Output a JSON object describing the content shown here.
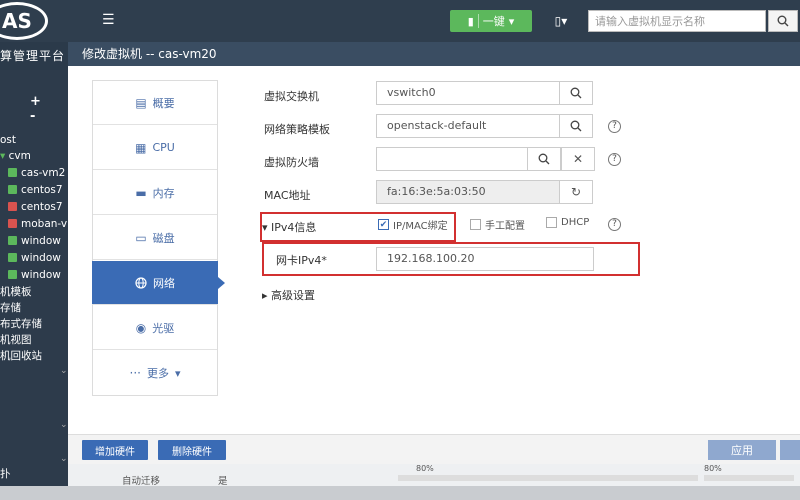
{
  "app": {
    "logo_text": "AS",
    "platform_title": "算管理平台"
  },
  "topbar": {
    "onekey_label": "一键",
    "search_placeholder": "请输入虚拟机显示名称"
  },
  "nav": {
    "tools_label": "+ -",
    "tree": [
      {
        "label": "ost",
        "icon": "none"
      },
      {
        "label": "cvm",
        "icon": "arrow"
      },
      {
        "label": "cas-vm2",
        "icon": "vm-running"
      },
      {
        "label": "centos7",
        "icon": "vm-running"
      },
      {
        "label": "centos7",
        "icon": "vm-stopped"
      },
      {
        "label": "moban-v",
        "icon": "vm-stopped"
      },
      {
        "label": "window",
        "icon": "vm-running"
      },
      {
        "label": "window",
        "icon": "vm-running"
      },
      {
        "label": "window",
        "icon": "vm-running"
      },
      {
        "label": "机模板",
        "icon": "none"
      },
      {
        "label": "存储",
        "icon": "none"
      },
      {
        "label": "布式存储",
        "icon": "none"
      },
      {
        "label": "机视图",
        "icon": "none"
      },
      {
        "label": "机回收站",
        "icon": "none"
      },
      {
        "label": "扑",
        "icon": "none"
      }
    ]
  },
  "modal": {
    "title": "修改虚拟机 -- cas-vm20",
    "tabs": [
      {
        "label": "概要",
        "icon": "summary-icon"
      },
      {
        "label": "CPU",
        "icon": "cpu-icon"
      },
      {
        "label": "内存",
        "icon": "memory-icon"
      },
      {
        "label": "磁盘",
        "icon": "disk-icon"
      },
      {
        "label": "网络",
        "icon": "network-icon"
      },
      {
        "label": "光驱",
        "icon": "cdrom-icon"
      },
      {
        "label": "更多",
        "icon": "more-icon"
      }
    ],
    "active_tab": "网络",
    "form": {
      "vswitch_label": "虚拟交换机",
      "vswitch_value": "vswitch0",
      "policy_label": "网络策略模板",
      "policy_value": "openstack-default",
      "firewall_label": "虚拟防火墙",
      "firewall_value": "",
      "mac_label": "MAC地址",
      "mac_value": "fa:16:3e:5a:03:50",
      "ipv4_section_label": "IPv4信息",
      "ip_mac_bind_label": "IP/MAC绑定",
      "ip_mac_bind_checked": true,
      "manual_label": "手工配置",
      "manual_checked": false,
      "dhcp_label": "DHCP",
      "dhcp_checked": false,
      "nic_ipv4_label": "网卡IPv4*",
      "nic_ipv4_value": "192.168.100.20",
      "advanced_label": "高级设置"
    },
    "footer": {
      "add_hw_label": "增加硬件",
      "remove_hw_label": "删除硬件",
      "apply_label": "应用"
    }
  },
  "background": {
    "row_label": "自动迁移",
    "row_value": "是",
    "pct_left": "80%",
    "pct_right": "80%"
  },
  "colors": {
    "accent": "#3a6bb5",
    "highlight_red": "#d23030",
    "topbar": "#2f3e4e",
    "success": "#5cb85c"
  }
}
